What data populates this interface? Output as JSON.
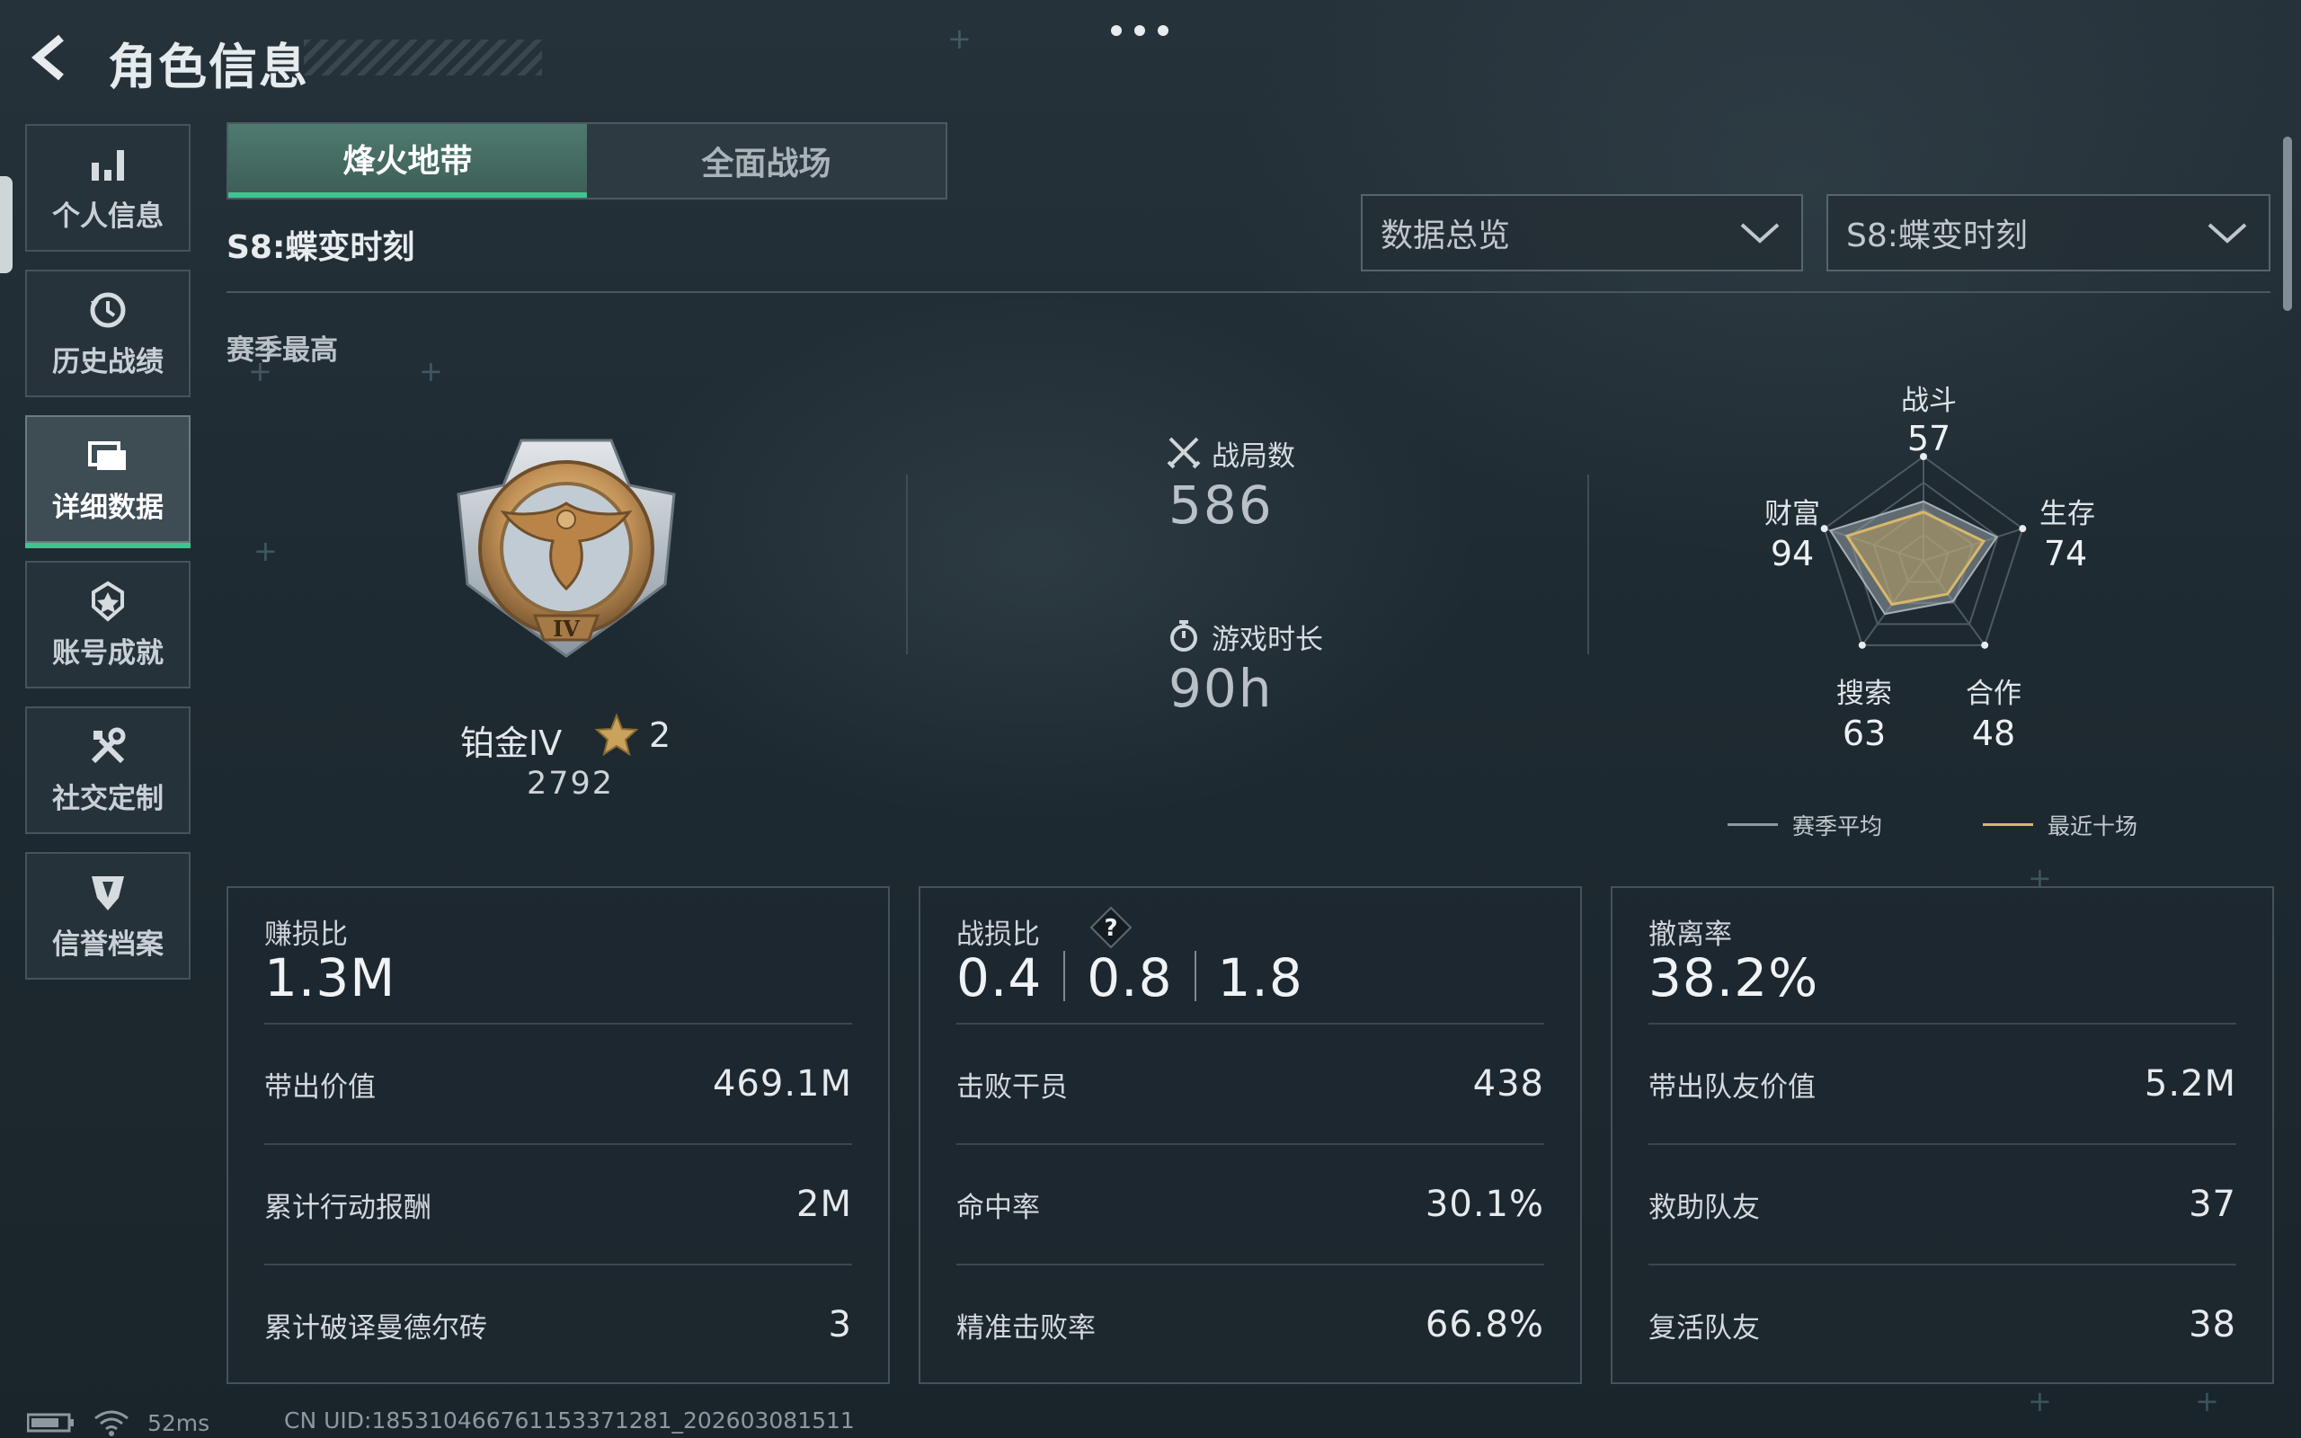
{
  "header": {
    "title": "角色信息",
    "back_icon": "back-arrow-icon",
    "more_icon": "more-dots-icon"
  },
  "sidebar": {
    "items": [
      {
        "label": "个人信息",
        "icon": "bar-chart-icon"
      },
      {
        "label": "历史战绩",
        "icon": "history-clock-icon"
      },
      {
        "label": "详细数据",
        "icon": "folder-icon",
        "active": true
      },
      {
        "label": "账号成就",
        "icon": "achievement-icon"
      },
      {
        "label": "社交定制",
        "icon": "tools-icon"
      },
      {
        "label": "信誉档案",
        "icon": "shield-icon"
      }
    ]
  },
  "tabs": [
    {
      "label": "烽火地带",
      "active": true
    },
    {
      "label": "全面战场",
      "active": false
    }
  ],
  "season_label": "S8:蝶变时刻",
  "filters": {
    "view": "数据总览",
    "season": "S8:蝶变时刻"
  },
  "season_best_label": "赛季最高",
  "rank": {
    "name": "铂金IV",
    "stars": "2",
    "score": "2792"
  },
  "stats": {
    "matches": {
      "label": "战局数",
      "value": "586",
      "icon": "crossed-swords-icon"
    },
    "playtime": {
      "label": "游戏时长",
      "value": "90h",
      "icon": "stopwatch-icon"
    }
  },
  "radar": {
    "axes": [
      {
        "label": "战斗",
        "value": "57"
      },
      {
        "label": "生存",
        "value": "74"
      },
      {
        "label": "合作",
        "value": "48"
      },
      {
        "label": "搜索",
        "value": "63"
      },
      {
        "label": "财富",
        "value": "94"
      }
    ],
    "legend": {
      "season_avg": "赛季平均",
      "recent_ten": "最近十场"
    },
    "colors": {
      "season_avg": "#8e9aa2",
      "recent_ten": "#d7b86a"
    }
  },
  "cards": [
    {
      "head": "赚损比",
      "big": "1.3M",
      "rows": [
        {
          "k": "带出价值",
          "v": "469.1M"
        },
        {
          "k": "累计行动报酬",
          "v": "2M"
        },
        {
          "k": "累计破译曼德尔砖",
          "v": "3"
        }
      ]
    },
    {
      "head": "战损比",
      "big_parts": [
        "0.4",
        "0.8",
        "1.8"
      ],
      "rows": [
        {
          "k": "击败干员",
          "v": "438"
        },
        {
          "k": "命中率",
          "v": "30.1%"
        },
        {
          "k": "精准击败率",
          "v": "66.8%"
        }
      ]
    },
    {
      "head": "撤离率",
      "big": "38.2%",
      "rows": [
        {
          "k": "带出队友价值",
          "v": "5.2M"
        },
        {
          "k": "救助队友",
          "v": "37"
        },
        {
          "k": "复活队友",
          "v": "38"
        }
      ]
    }
  ],
  "footer": {
    "ping": "52ms",
    "uid": "CN UID:18531046676115337128‌1_202603081511"
  },
  "accent": "#3fc48f"
}
